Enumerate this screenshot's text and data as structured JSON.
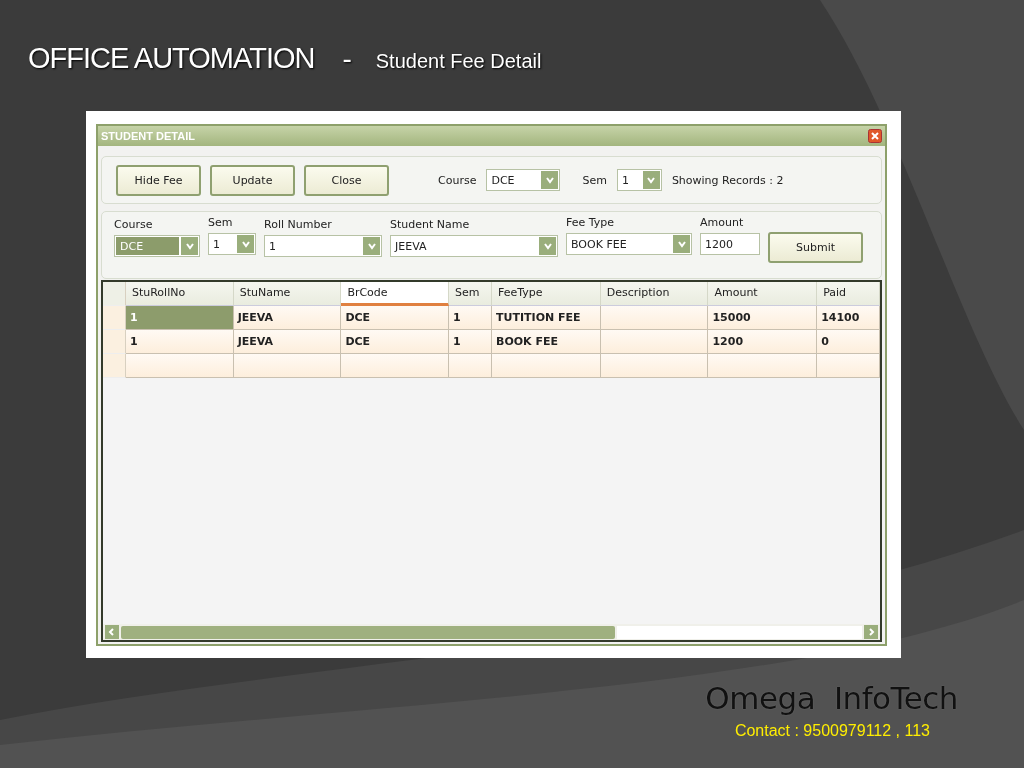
{
  "slide": {
    "title": "OFFICE AUTOMATION",
    "separator": "-",
    "subtitle": "Student Fee Detail",
    "brand": "Omega  InfoTech",
    "contact": "Contact : 9500979112 , 113"
  },
  "window": {
    "title": "STUDENT DETAIL"
  },
  "toolbar": {
    "buttons": [
      "Hide Fee",
      "Update",
      "Close"
    ],
    "filters": [
      {
        "label": "Course",
        "value": "DCE",
        "kind": "course"
      },
      {
        "label": "Sem",
        "value": "1",
        "kind": "sem"
      }
    ],
    "status": "Showing Records : 2"
  },
  "form": {
    "fields": [
      {
        "label": "Course",
        "value": "DCE",
        "kind": "dropdown",
        "focused": true
      },
      {
        "label": "Sem",
        "value": "1",
        "kind": "dropdown",
        "focused": false
      },
      {
        "label": "Roll Number",
        "value": "1",
        "kind": "dropdown",
        "focused": false
      },
      {
        "label": "Student Name",
        "value": "JEEVA",
        "kind": "dropdown",
        "focused": false
      },
      {
        "label": "Fee Type",
        "value": "BOOK FEE",
        "kind": "dropdown",
        "focused": false
      },
      {
        "label": "Amount",
        "value": "1200",
        "kind": "text",
        "focused": false
      }
    ],
    "submit": "Submit"
  },
  "table": {
    "columns": [
      {
        "label": "StuRollNo",
        "highlighted": false
      },
      {
        "label": "StuName",
        "highlighted": false
      },
      {
        "label": "BrCode",
        "highlighted": true
      },
      {
        "label": "Sem",
        "highlighted": false
      },
      {
        "label": "FeeType",
        "highlighted": false
      },
      {
        "label": "Description",
        "highlighted": false
      },
      {
        "label": "Amount",
        "highlighted": false
      },
      {
        "label": "Paid",
        "highlighted": false
      }
    ],
    "rows": [
      {
        "selected": true,
        "cells": [
          "1",
          "JEEVA",
          "DCE",
          "1",
          "TUTITION FEE",
          "",
          "15000",
          "14100"
        ]
      },
      {
        "selected": false,
        "cells": [
          "1",
          "JEEVA",
          "DCE",
          "1",
          "BOOK FEE",
          "",
          "1200",
          "0"
        ]
      }
    ]
  }
}
